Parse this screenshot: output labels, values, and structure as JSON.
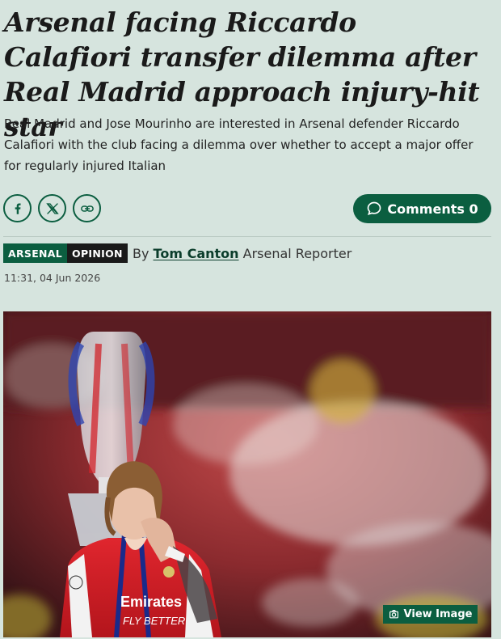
{
  "article": {
    "headline": "Arsenal facing Riccardo Calafiori transfer dilemma after Real Madrid approach injury-hit star",
    "standfirst": "Real Madrid and Jose Mourinho are interested in Arsenal defender Riccardo Calafiori with the club facing a dilemma over whether to accept a major offer for regularly injured Italian"
  },
  "share": {
    "icons": [
      "facebook-icon",
      "x-icon",
      "link-icon"
    ]
  },
  "comments": {
    "label": "Comments 0",
    "icon": "speech-bubble-icon"
  },
  "tags": {
    "primary": "ARSENAL",
    "secondary": "OPINION"
  },
  "byline": {
    "prefix": "By",
    "author": "Tom Canton",
    "role": "Arsenal Reporter"
  },
  "timestamp": "11:31, 04 Jun 2026",
  "hero_image": {
    "shirt_text_1": "Emirates",
    "shirt_text_2": "FLY BETTER",
    "view_label": "View Image",
    "view_icon": "camera-icon"
  },
  "colors": {
    "background": "#d6e4de",
    "accent": "#0b5e40",
    "opinion_tag": "#1a1a1a"
  }
}
